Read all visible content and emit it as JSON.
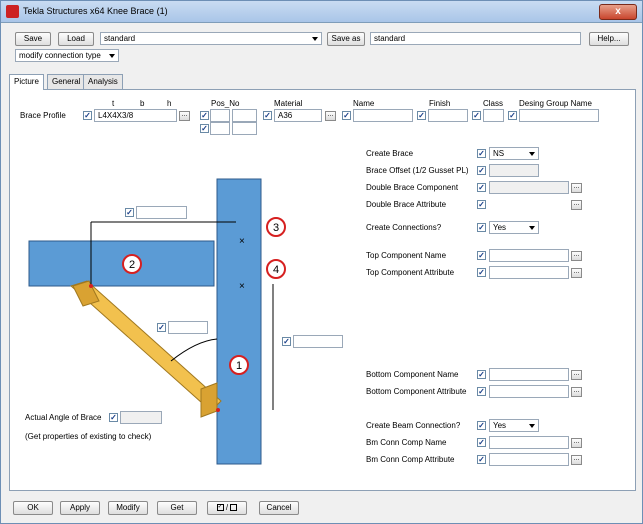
{
  "window": {
    "title": "Tekla Structures x64  Knee Brace (1)",
    "close": "x"
  },
  "toolbar": {
    "save": "Save",
    "load": "Load",
    "preset": "standard",
    "save_as": "Save as",
    "save_as_value": "standard",
    "help": "Help..."
  },
  "connection_type": "modify connection type",
  "tabs": [
    "Picture",
    "General",
    "Analysis"
  ],
  "headers": {
    "t": "t",
    "b": "b",
    "h": "h",
    "pos_no": "Pos_No",
    "material": "Material",
    "name": "Name",
    "finish": "Finish",
    "class": "Class",
    "group": "Desing Group Name"
  },
  "brace_profile": {
    "label": "Brace Profile",
    "value": "L4X4X3/8",
    "material": "A36"
  },
  "right": {
    "create_brace": "Create Brace",
    "create_brace_val": "NS",
    "brace_offset": "Brace Offset (1/2 Gusset PL)",
    "double_comp": "Double Brace Component",
    "double_attr": "Double Brace Attribute",
    "create_conn": "Create Connections?",
    "create_conn_val": "Yes",
    "top_name": "Top Component Name",
    "top_attr": "Top Component Attribute",
    "bottom_name": "Bottom Component Name",
    "bottom_attr": "Bottom Component Attribute",
    "create_beam": "Create Beam Connection?",
    "create_beam_val": "Yes",
    "bm_name": "Bm Conn Comp Name",
    "bm_attr": "Bm Conn Comp Attribute"
  },
  "angle": {
    "label": "Actual Angle of Brace",
    "note": "(Get properties of existing to check)"
  },
  "callouts": [
    "1",
    "2",
    "3",
    "4"
  ],
  "bottom": {
    "ok": "OK",
    "apply": "Apply",
    "modify": "Modify",
    "get": "Get",
    "toggle": "/",
    "cancel": "Cancel"
  },
  "colors": {
    "member_blue": "#5b9bd5",
    "brace_yellow": "#f2c14e",
    "callout_red": "#d62020"
  }
}
